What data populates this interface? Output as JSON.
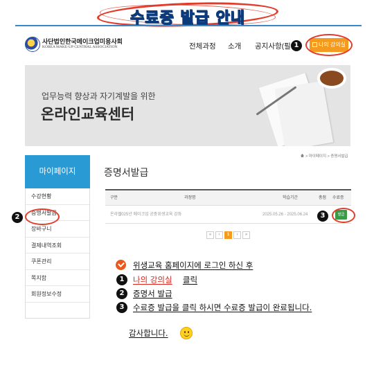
{
  "banner": {
    "title": "수료증 발급 안내"
  },
  "header": {
    "logo_kr": "사단법인한국메이크업미용사회",
    "logo_en": "KOREA MAKE-UP CENTRAL ASSOCIATION",
    "nav": [
      "전체과정",
      "소개",
      "공지사항(필독"
    ],
    "myclass_label": "나의 강의실",
    "step_badge": "1"
  },
  "hero": {
    "subtitle": "업무능력 향상과 자기계발을 위한",
    "title": "온라인교육센터"
  },
  "sidebar": {
    "heading": "마이페이지",
    "items": [
      "수강현황",
      "증명서발급",
      "장바구니",
      "결제내역조회",
      "쿠폰관리",
      "쪽지함",
      "회원정보수정"
    ],
    "active_index": 1,
    "step_badge": "2"
  },
  "main": {
    "breadcrumb": "> 마이페이지 > 증명서발급",
    "page_title": "증명서발급",
    "table": {
      "headers": [
        "구분",
        "과정명",
        "학습기간",
        "총점",
        "수료증"
      ],
      "rows": [
        {
          "type": "온라인",
          "course": "2025년 메이크업 공중위생교육 강좌",
          "period": "2025.05.26 - 2025.06.24",
          "grade": "",
          "cert_button": "발급"
        }
      ]
    },
    "step_badge": "3",
    "pagination": {
      "first": "«",
      "prev": "‹",
      "current": "1",
      "next": "›",
      "last": "»"
    }
  },
  "instructions": {
    "intro": "위생교육 홈페이지에 로그인 하신 후",
    "steps": [
      {
        "badge": "1",
        "text": "나의 강의실",
        "suffix": "클릭"
      },
      {
        "badge": "2",
        "text": "증명서 발급"
      },
      {
        "badge": "3",
        "text": "수료증 발급을 클릭 하시면 수료증 발급이 완료됩니다."
      }
    ],
    "thanks": "감사합니다."
  },
  "colors": {
    "accent_blue": "#2a9ad5",
    "orange": "#f39a1f",
    "highlight_red": "#e23b2b",
    "green_button": "#3a9a48"
  }
}
